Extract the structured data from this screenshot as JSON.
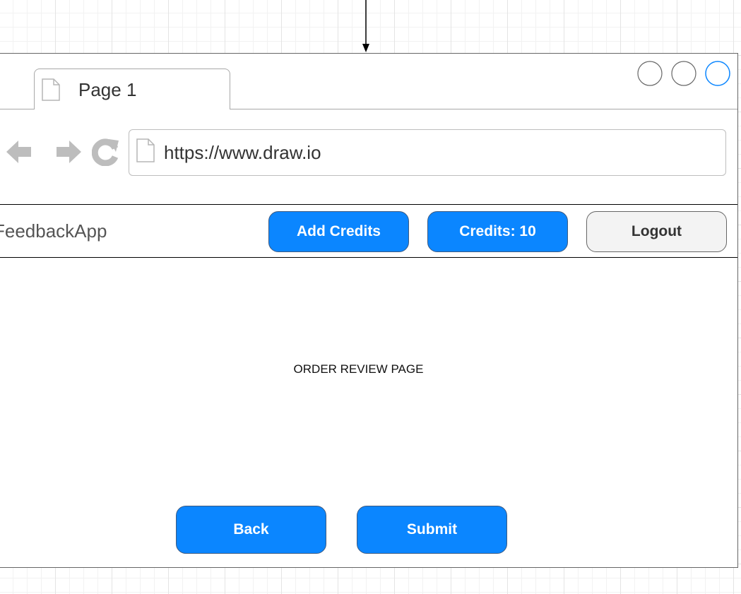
{
  "browser": {
    "tab": {
      "label": "Page 1",
      "icon": "page-icon"
    },
    "window_controls": [
      "circle",
      "circle",
      "circle"
    ],
    "nav": {
      "back_icon": "arrow-left-icon",
      "forward_icon": "arrow-right-icon",
      "reload_icon": "reload-icon"
    },
    "address_bar": {
      "url": "https://www.draw.io",
      "icon": "page-icon"
    }
  },
  "appbar": {
    "title": "FeedbackApp",
    "add_credits_label": "Add Credits",
    "credits_label": "Credits: 10",
    "logout_label": "Logout"
  },
  "main": {
    "heading": "ORDER REVIEW PAGE",
    "back_label": "Back",
    "submit_label": "Submit"
  },
  "colors": {
    "primary_button": "#0b86ff",
    "secondary_button": "#f3f3f3",
    "active_control": "#0b86ff",
    "nav_icons": "#bdbdbd"
  }
}
